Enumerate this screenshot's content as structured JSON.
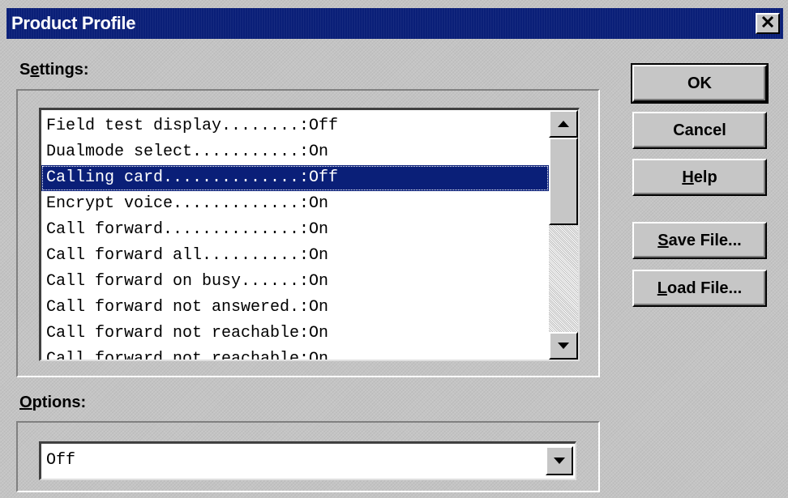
{
  "window": {
    "title": "Product Profile",
    "close_icon": "close-icon"
  },
  "settings": {
    "label_prefix": "S",
    "label_accel": "e",
    "label_suffix": "ttings:",
    "items": [
      "Field test display........:Off",
      "Dualmode select...........:On",
      "Calling card..............:Off",
      "Encrypt voice.............:On",
      "Call forward..............:On",
      "Call forward all..........:On",
      "Call forward on busy......:On",
      "Call forward not answered.:On",
      "Call forward not reachable:On",
      "Call forward not reachable:On"
    ],
    "selected_index": 2
  },
  "options": {
    "label_accel": "O",
    "label_suffix": "ptions:",
    "value": "Off"
  },
  "buttons": {
    "ok": "OK",
    "cancel": "Cancel",
    "help_accel": "H",
    "help_rest": "elp",
    "save_accel": "S",
    "save_rest": "ave File...",
    "load_accel": "L",
    "load_rest": "oad File..."
  },
  "colors": {
    "titlebar": "#0a1f78",
    "selection": "#0a1f78",
    "face": "#c6c6c6"
  }
}
